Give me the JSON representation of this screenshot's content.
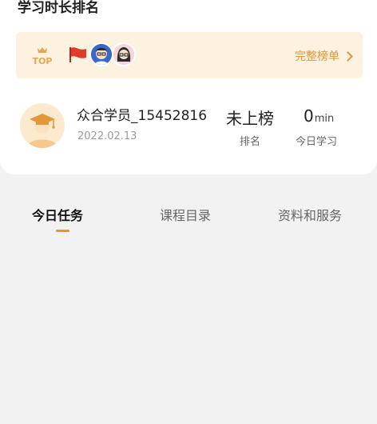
{
  "section": {
    "title": "学习时长排名"
  },
  "rank_banner": {
    "top_badge_text": "TOP",
    "full_rank_label": "完整榜单",
    "icons": [
      "crown-icon",
      "flag-icon",
      "avatar-boy",
      "avatar-girl",
      "chevron-right-icon"
    ],
    "accent_color": "#e0983a"
  },
  "user": {
    "name": "众合学员_15452816",
    "date": "2022.02.13",
    "rank_value": "未上榜",
    "rank_label": "排名",
    "time_value": "0",
    "time_unit": "min",
    "time_label": "今日学习"
  },
  "tabs": [
    {
      "label": "今日任务",
      "active": true
    },
    {
      "label": "课程目录",
      "active": false
    },
    {
      "label": "资料和服务",
      "active": false
    }
  ]
}
